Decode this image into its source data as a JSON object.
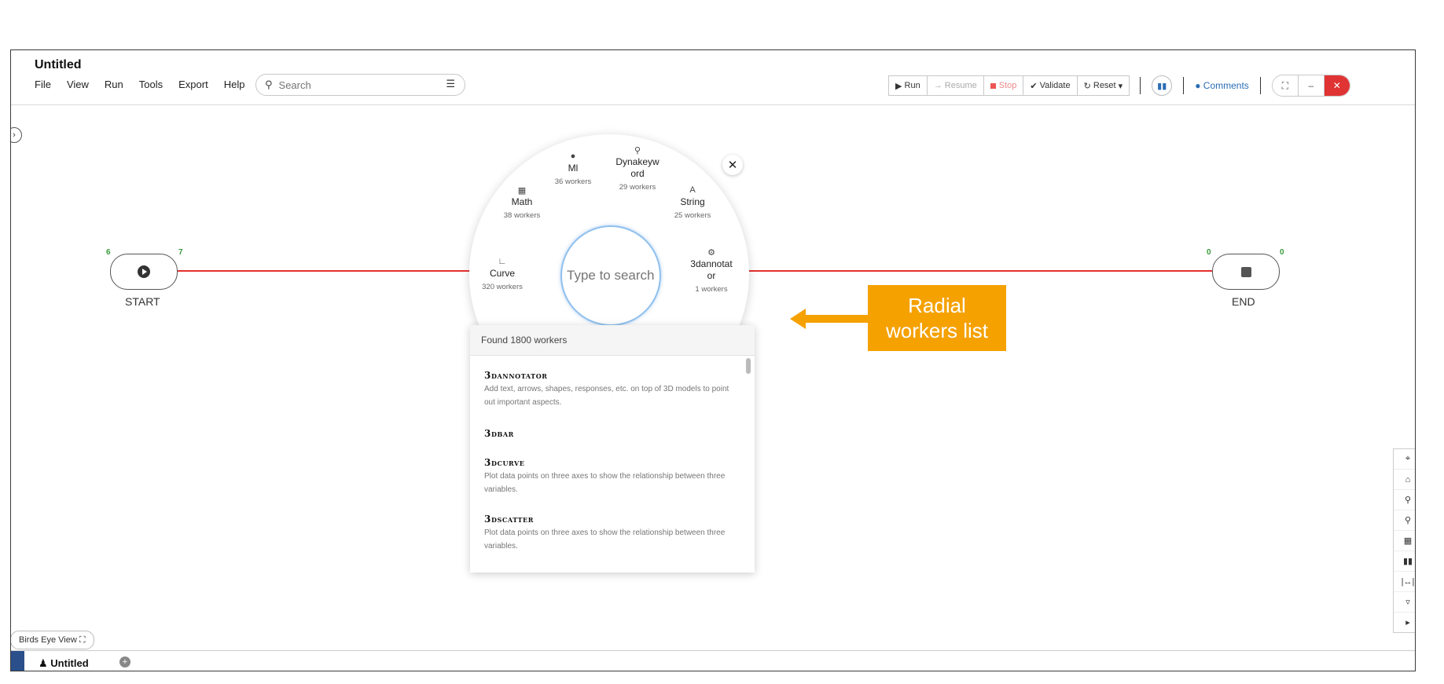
{
  "app": {
    "title": "Untitled",
    "menu": [
      "File",
      "View",
      "Run",
      "Tools",
      "Export",
      "Help"
    ],
    "search": {
      "placeholder": "Search",
      "value": ""
    }
  },
  "toolbar": {
    "run": "Run",
    "resume": "Resume",
    "stop": "Stop",
    "validate": "Validate",
    "reset": "Reset",
    "comments": "Comments"
  },
  "flow": {
    "start": {
      "label": "START",
      "port_left": "6",
      "port_right": "7"
    },
    "end": {
      "label": "END",
      "port_left": "0",
      "port_right": "0"
    }
  },
  "radial": {
    "search_placeholder": "Type to search",
    "items": [
      {
        "icon": "brain-icon",
        "name": "Ml",
        "count": "36 workers"
      },
      {
        "icon": "key-icon",
        "name": "Dynakeyw\nord",
        "count": "29 workers"
      },
      {
        "icon": "calculator-icon",
        "name": "Math",
        "count": "38 workers"
      },
      {
        "icon": "text-icon",
        "name": "String",
        "count": "25 workers"
      },
      {
        "icon": "chart-icon",
        "name": "Curve",
        "count": "320 workers"
      },
      {
        "icon": "gear-icon",
        "name": "3dannotat\nor",
        "count": "1 workers"
      }
    ]
  },
  "results": {
    "header": "Found 1800 workers",
    "items": [
      {
        "title": "3dannotator",
        "desc": "Add text, arrows, shapes, responses, etc. on top of 3D models to point out important aspects."
      },
      {
        "title": "3dbar",
        "desc": ""
      },
      {
        "title": "3dcurve",
        "desc": "Plot data points on three axes to show the relationship between three variables."
      },
      {
        "title": "3dscatter",
        "desc": "Plot data points on three axes to show the relationship between three variables."
      }
    ]
  },
  "callout": {
    "text": "Radial\nworkers list",
    "color": "#f5a100"
  },
  "colors": {
    "accent": "#2a6db5",
    "flow_line": "#e53030",
    "port": "#3a9a3a",
    "close": "#e03434"
  },
  "footer": {
    "birds_eye": "Birds Eye View",
    "tab": "Untitled"
  }
}
